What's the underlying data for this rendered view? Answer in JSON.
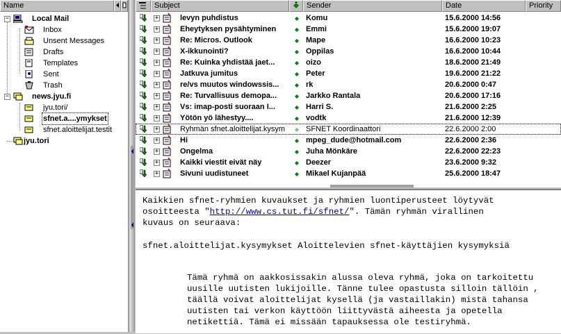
{
  "folder_pane": {
    "header": "Name",
    "local_mail": "Local Mail",
    "local_folders": [
      "Inbox",
      "Unsent Messages",
      "Drafts",
      "Templates",
      "Sent",
      "Trash"
    ],
    "server": "news.jyu.fi",
    "newsgroups": [
      "jyu.tori/",
      "sfnet.a....ymykset",
      "sfnet.aloittelijat.testit"
    ],
    "other_server": "jyu.tori"
  },
  "message_list": {
    "columns": {
      "subject": "Subject",
      "sender": "Sender",
      "date": "Date",
      "priority": "Priority"
    },
    "rows": [
      {
        "subject": "levyn puhdistus",
        "sender": "Komu",
        "date": "15.6.2000 14:56",
        "bold": true
      },
      {
        "subject": "Eheytyksen pysähtyminen",
        "sender": "Emmi",
        "date": "15.6.2000 19:07",
        "bold": true
      },
      {
        "subject": "Re: Micros. Outlook",
        "sender": "Mape",
        "date": "16.6.2000 10:23",
        "bold": true
      },
      {
        "subject": "X-ikkunointi?",
        "sender": "Oppilas",
        "date": "16.6.2000 10:44",
        "bold": true
      },
      {
        "subject": "Re: Kuinka yhdistää jaet...",
        "sender": "oizo",
        "date": "18.6.2000 21:49",
        "bold": true
      },
      {
        "subject": "Jatkuva jumitus",
        "sender": "Peter",
        "date": "19.6.2000 21:22",
        "bold": true
      },
      {
        "subject": "re/vs muutos windowssis...",
        "sender": "rk",
        "date": "20.6.2000 0:47",
        "bold": true
      },
      {
        "subject": "Re: Turvallisuus demopa...",
        "sender": "Jarkko Rantala",
        "date": "20.6.2000 17:16",
        "bold": true
      },
      {
        "subject": "Vs: imap-posti suoraan I...",
        "sender": "Harri S.",
        "date": "21.6.2000 2:25",
        "bold": true
      },
      {
        "subject": "Yötön yö lähestyy....",
        "sender": "vodtk",
        "date": "21.6.2000 12:39",
        "bold": true
      },
      {
        "subject": "Ryhmän sfnet.aloittelijat.kysym...",
        "sender": "SFNET Koordinaattori",
        "date": "22.6.2000 2:00",
        "bold": false,
        "selected": true
      },
      {
        "subject": "Hi",
        "sender": "mpeg_dude@hotmail.com",
        "date": "22.6.2000 2:36",
        "bold": true
      },
      {
        "subject": "Ongelma",
        "sender": "Juha Mönkäre",
        "date": "22.6.2000 22:23",
        "bold": true
      },
      {
        "subject": "Kaikki viestit eivät näy",
        "sender": "Deezer",
        "date": "23.6.2000 9:32",
        "bold": true
      },
      {
        "subject": "Sivuni uudistuneet",
        "sender": "Mikael Kujanpää",
        "date": "25.6.2000 18:47",
        "bold": true
      }
    ]
  },
  "preview": {
    "line1": "Kaikkien sfnet-ryhmien kuvaukset ja ryhmien luontiperusteet löytyvät",
    "line2_pre": "osoitteesta \"",
    "line2_link": "http://www.cs.tut.fi/sfnet/",
    "line2_post": "\". Tämän ryhmän virallinen",
    "line3": "kuvaus on seuraava:",
    "group_line": "sfnet.aloittelijat.kysymykset Aloittelevien sfnet-käyttäjien kysymyksiä",
    "para": [
      "Tämä ryhmä on aakkosissakin alussa oleva ryhmä, joka on tarkoitettu",
      "uusille uutisten lukijoille. Tänne tulee opastusta silloin tällöin ,",
      "täällä voivat aloittelijat kysellä (ja vastaillakin) mistä tahansa",
      "uutisten tai verkon käyttöön liittyvästä aiheesta ja opetella",
      "netikettiä. Tämä ei missään tapauksessa ole testiryhmä."
    ]
  },
  "colors": {
    "unread_arrow": "#008000",
    "diamond": "#008000",
    "link": "#00008b"
  }
}
